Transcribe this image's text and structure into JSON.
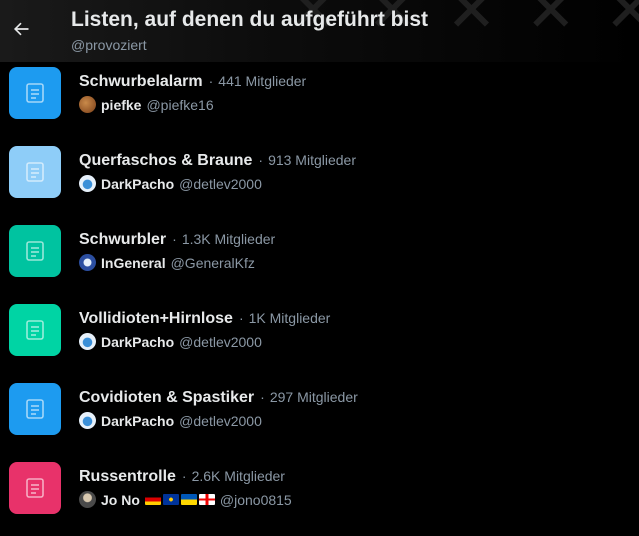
{
  "header": {
    "title": "Listen, auf denen du aufgeführt bist",
    "handle": "@provoziert",
    "back_icon": "arrow-left-icon"
  },
  "lists": [
    {
      "name": "Schwurbelalarm",
      "members": "441 Mitglieder",
      "owner_name": "piefke",
      "owner_handle": "@piefke16",
      "icon_color": "#1d9bf0"
    },
    {
      "name": "Querfaschos & Braune",
      "members": "913 Mitglieder",
      "owner_name": "DarkPacho",
      "owner_handle": "@detlev2000",
      "icon_color": "#8ecdf8"
    },
    {
      "name": "Schwurbler",
      "members": "1.3K Mitglieder",
      "owner_name": "InGeneral",
      "owner_handle": "@GeneralKfz",
      "icon_color": "#00c3a0"
    },
    {
      "name": "Vollidioten+Hirnlose",
      "members": "1K Mitglieder",
      "owner_name": "DarkPacho",
      "owner_handle": "@detlev2000",
      "icon_color": "#00d4a4"
    },
    {
      "name": "Covidioten & Spastiker",
      "members": "297 Mitglieder",
      "owner_name": "DarkPacho",
      "owner_handle": "@detlev2000",
      "icon_color": "#1d9bf0"
    },
    {
      "name": "Russentrolle",
      "members": "2.6K Mitglieder",
      "owner_name": "Jo No",
      "owner_handle": "@jono0815",
      "icon_color": "#e8326a"
    }
  ]
}
